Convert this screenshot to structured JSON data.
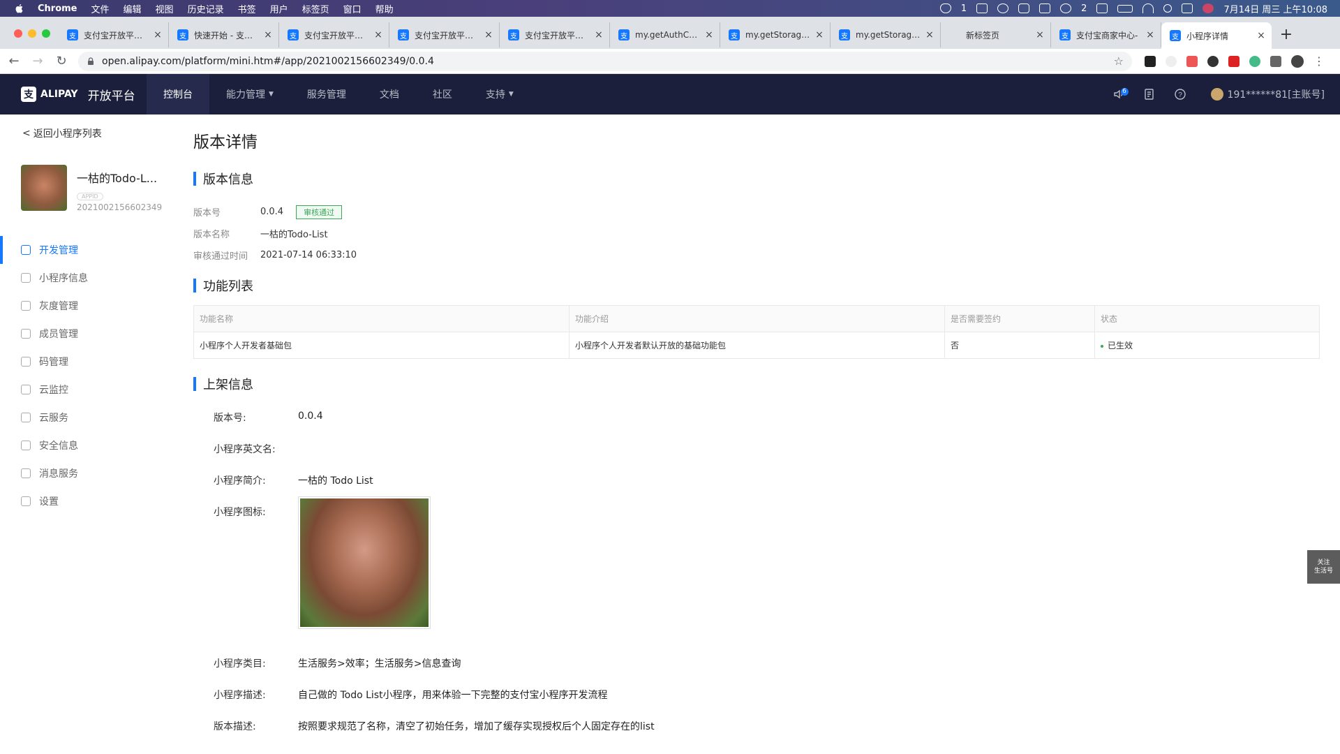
{
  "menubar": {
    "app": "Chrome",
    "items": [
      "文件",
      "编辑",
      "视图",
      "历史记录",
      "书签",
      "用户",
      "标签页",
      "窗口",
      "帮助"
    ],
    "status_items": [
      "1",
      "2"
    ],
    "clock": "7月14日 周三 上午10:08"
  },
  "tabs": [
    {
      "title": "支付宝开放平台文",
      "icon": "alipay"
    },
    {
      "title": "快速开始 - 支付宝",
      "icon": "alipay"
    },
    {
      "title": "支付宝开放平台文",
      "icon": "alipay"
    },
    {
      "title": "支付宝开放平台文",
      "icon": "alipay"
    },
    {
      "title": "支付宝开放平台文",
      "icon": "alipay"
    },
    {
      "title": "my.getAuthCode",
      "icon": "alipay"
    },
    {
      "title": "my.getStorageS",
      "icon": "alipay"
    },
    {
      "title": "my.getStorageS",
      "icon": "alipay"
    },
    {
      "title": "新标签页",
      "icon": "none"
    },
    {
      "title": "支付宝商家中心-",
      "icon": "alipay"
    },
    {
      "title": "小程序详情",
      "icon": "alipay"
    }
  ],
  "address": {
    "url": "open.alipay.com/platform/mini.htm#/app/2021002156602349/0.0.4"
  },
  "header": {
    "logo_text": "ALIPAY",
    "platform": "开放平台",
    "nav": [
      {
        "label": "控制台",
        "active": true,
        "dropdown": false
      },
      {
        "label": "能力管理",
        "active": false,
        "dropdown": true
      },
      {
        "label": "服务管理",
        "active": false,
        "dropdown": false
      },
      {
        "label": "文档",
        "active": false,
        "dropdown": false
      },
      {
        "label": "社区",
        "active": false,
        "dropdown": false
      },
      {
        "label": "支持",
        "active": false,
        "dropdown": true
      }
    ],
    "notify_count": "6",
    "account": "191******81[主账号]"
  },
  "sidebar": {
    "back": "返回小程序列表",
    "app_name": "一枯的Todo-L...",
    "appid_tag": "APPID",
    "appid": "2021002156602349",
    "menu": [
      {
        "label": "开发管理",
        "active": true
      },
      {
        "label": "小程序信息",
        "active": false
      },
      {
        "label": "灰度管理",
        "active": false
      },
      {
        "label": "成员管理",
        "active": false
      },
      {
        "label": "码管理",
        "active": false
      },
      {
        "label": "云监控",
        "active": false
      },
      {
        "label": "云服务",
        "active": false
      },
      {
        "label": "安全信息",
        "active": false
      },
      {
        "label": "消息服务",
        "active": false
      },
      {
        "label": "设置",
        "active": false
      }
    ]
  },
  "main": {
    "title": "版本详情",
    "version_section": "版本信息",
    "version_info": [
      {
        "k": "版本号",
        "v": "0.0.4",
        "tag": "审核通过"
      },
      {
        "k": "版本名称",
        "v": "一枯的Todo-List"
      },
      {
        "k": "审核通过时间",
        "v": "2021-07-14 06:33:10"
      }
    ],
    "feature_section": "功能列表",
    "feature_headers": [
      "功能名称",
      "功能介绍",
      "是否需要签约",
      "状态"
    ],
    "feature_rows": [
      {
        "name": "小程序个人开发者基础包",
        "desc": "小程序个人开发者默认开放的基础功能包",
        "sign": "否",
        "status": "已生效"
      }
    ],
    "listing_section": "上架信息",
    "listing": {
      "version_k": "版本号:",
      "version_v": "0.0.4",
      "en_name_k": "小程序英文名:",
      "en_name_v": "",
      "intro_k": "小程序简介:",
      "intro_v": "一枯的 Todo List",
      "icon_k": "小程序图标:",
      "category_k": "小程序类目:",
      "category_v": "生活服务>效率；生活服务>信息查询",
      "desc_k": "小程序描述:",
      "desc_v": "自己做的 Todo List小程序，用来体验一下完整的支付宝小程序开发流程",
      "verdesc_k": "版本描述:",
      "verdesc_v": "按照要求规范了名称，清空了初始任务，增加了缓存实现授权后个人固定存在的list"
    },
    "float_line1": "关注",
    "float_line2": "生活号"
  }
}
